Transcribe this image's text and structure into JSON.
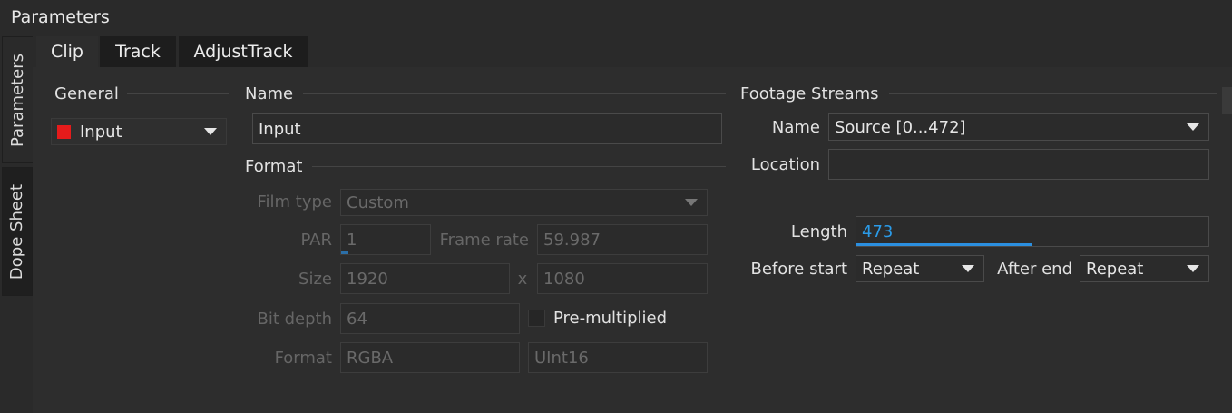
{
  "panel": {
    "title": "Parameters"
  },
  "side_tabs": [
    {
      "label": "Parameters",
      "active": true
    },
    {
      "label": "Dope Sheet",
      "active": false
    }
  ],
  "tabs": [
    {
      "label": "Clip",
      "active": true
    },
    {
      "label": "Track",
      "active": false
    },
    {
      "label": "AdjustTrack",
      "active": false
    }
  ],
  "general": {
    "heading": "General",
    "clip_select": {
      "value": "Input",
      "color": "#e51b1b"
    }
  },
  "name_section": {
    "heading": "Name",
    "value": "Input"
  },
  "format_section": {
    "heading": "Format",
    "film_type_label": "Film type",
    "film_type_value": "Custom",
    "par_label": "PAR",
    "par_value": "1",
    "frame_rate_label": "Frame rate",
    "frame_rate_value": "59.987",
    "size_label": "Size",
    "size_width": "1920",
    "size_separator": "x",
    "size_height": "1080",
    "bit_depth_label": "Bit depth",
    "bit_depth_value": "64",
    "premultiplied_label": "Pre-multiplied",
    "premultiplied_checked": false,
    "format_label": "Format",
    "format_value": "RGBA",
    "format_type": "UInt16"
  },
  "footage": {
    "heading": "Footage Streams",
    "name_label": "Name",
    "name_value": "Source [0...472]",
    "location_label": "Location",
    "location_value": "",
    "length_label": "Length",
    "length_value": "473",
    "before_start_label": "Before start",
    "before_start_value": "Repeat",
    "after_end_label": "After end",
    "after_end_value": "Repeat"
  }
}
